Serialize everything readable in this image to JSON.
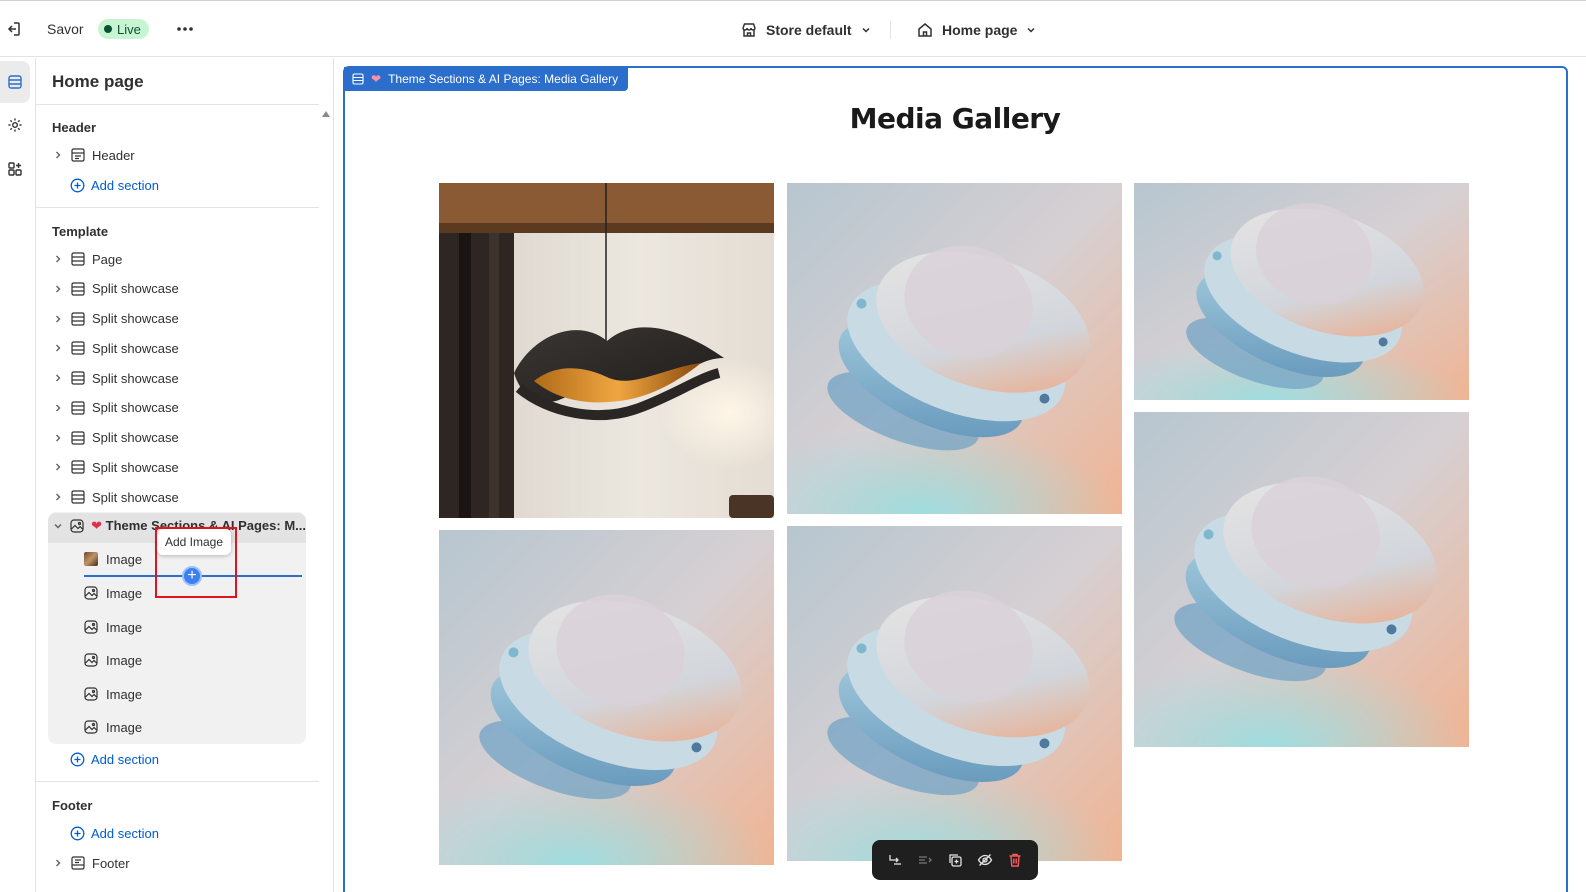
{
  "topbar": {
    "store_name": "Savor",
    "status_badge": "Live",
    "store_selector": "Store default",
    "page_selector": "Home page"
  },
  "sidebar": {
    "title": "Home page",
    "groups": {
      "header": {
        "title": "Header",
        "items": [
          "Header"
        ],
        "add_label": "Add section"
      },
      "template": {
        "title": "Template",
        "items": [
          "Page",
          "Split showcase",
          "Split showcase",
          "Split showcase",
          "Split showcase",
          "Split showcase",
          "Split showcase",
          "Split showcase",
          "Split showcase"
        ],
        "expanded_section": "Theme Sections & AI Pages: M...",
        "blocks": [
          "Image",
          "Image",
          "Image",
          "Image",
          "Image",
          "Image"
        ],
        "add_label": "Add section"
      },
      "footer": {
        "title": "Footer",
        "add_label": "Add section",
        "items": [
          "Footer"
        ]
      }
    },
    "tooltip": "Add Image"
  },
  "preview": {
    "section_tag": "Theme Sections & AI Pages: Media Gallery",
    "gallery_title": "Media Gallery"
  },
  "colors": {
    "accent": "#2c6ecb",
    "link": "#005bd3",
    "live_bg": "#c7f5d2",
    "live_fg": "#0c5132",
    "danger": "#e0141e"
  },
  "icons": {
    "exit": "exit-icon",
    "more": "more-horizontal-icon",
    "store": "store-icon",
    "home": "home-icon",
    "sections": "sections-icon",
    "settings": "gear-icon",
    "apps": "apps-icon"
  }
}
